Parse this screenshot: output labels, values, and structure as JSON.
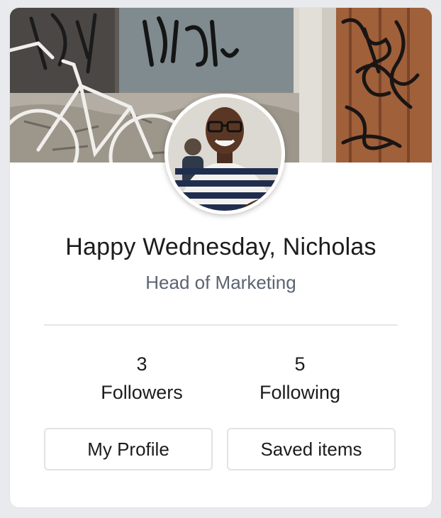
{
  "profile_card": {
    "greeting": "Happy Wednesday, Nicholas",
    "job_title": "Head of Marketing",
    "stats": [
      {
        "value": "3",
        "label": "Followers"
      },
      {
        "value": "5",
        "label": "Following"
      }
    ],
    "buttons": {
      "my_profile": "My Profile",
      "saved_items": "Saved items"
    }
  },
  "images": {
    "cover": "graffiti-wall-with-bicycle-photo",
    "avatar": "user-avatar-photo"
  },
  "colors": {
    "page_background": "#e9eaee",
    "card_background": "#ffffff",
    "text_primary": "#1c1c1e",
    "text_secondary": "#5b6472",
    "border": "#e1e3e6"
  }
}
